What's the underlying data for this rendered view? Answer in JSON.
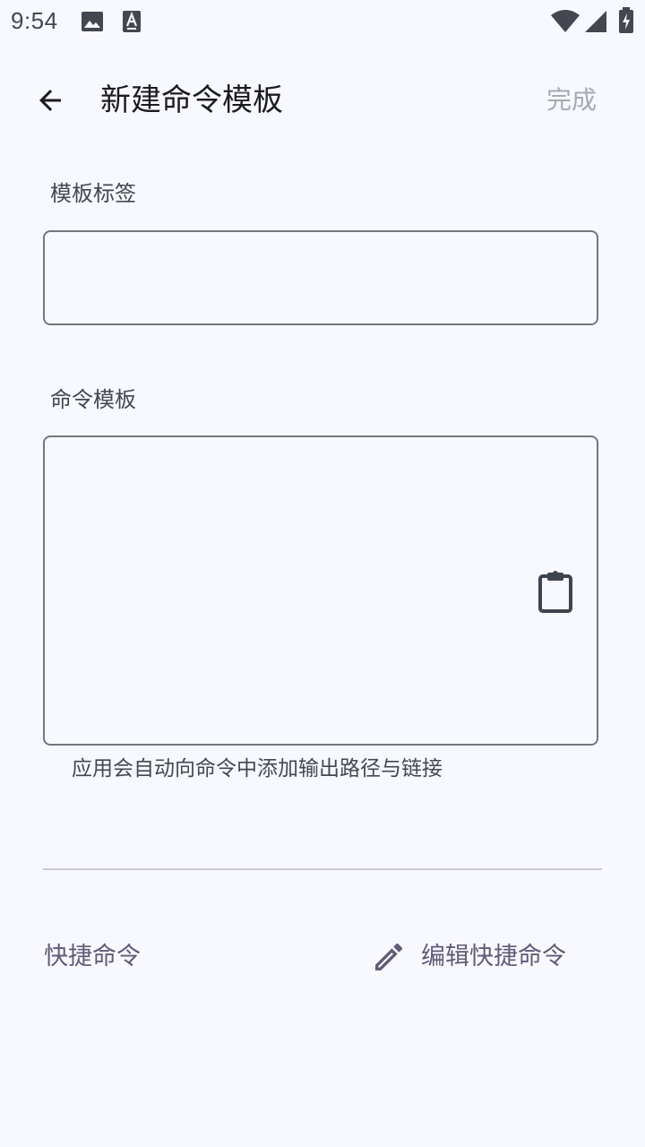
{
  "status_bar": {
    "time": "9:54",
    "icons": [
      "image-icon",
      "font-icon",
      "wifi-icon",
      "signal-icon",
      "battery-icon"
    ]
  },
  "app_bar": {
    "title": "新建命令模板",
    "done_label": "完成",
    "back_icon": "arrow-back-icon"
  },
  "form": {
    "label_field": {
      "label": "模板标签",
      "value": ""
    },
    "template_field": {
      "label": "命令模板",
      "value": "",
      "paste_icon": "clipboard-icon"
    },
    "helper_text": "应用会自动向命令中添加输出路径与链接"
  },
  "shortcuts": {
    "label": "快捷命令",
    "edit_label": "编辑快捷命令",
    "edit_icon": "pencil-icon"
  },
  "colors": {
    "background": "#f8f9fe",
    "outline": "#74777f",
    "accent": "#615a78",
    "disabled_text": "#a9aab1"
  }
}
